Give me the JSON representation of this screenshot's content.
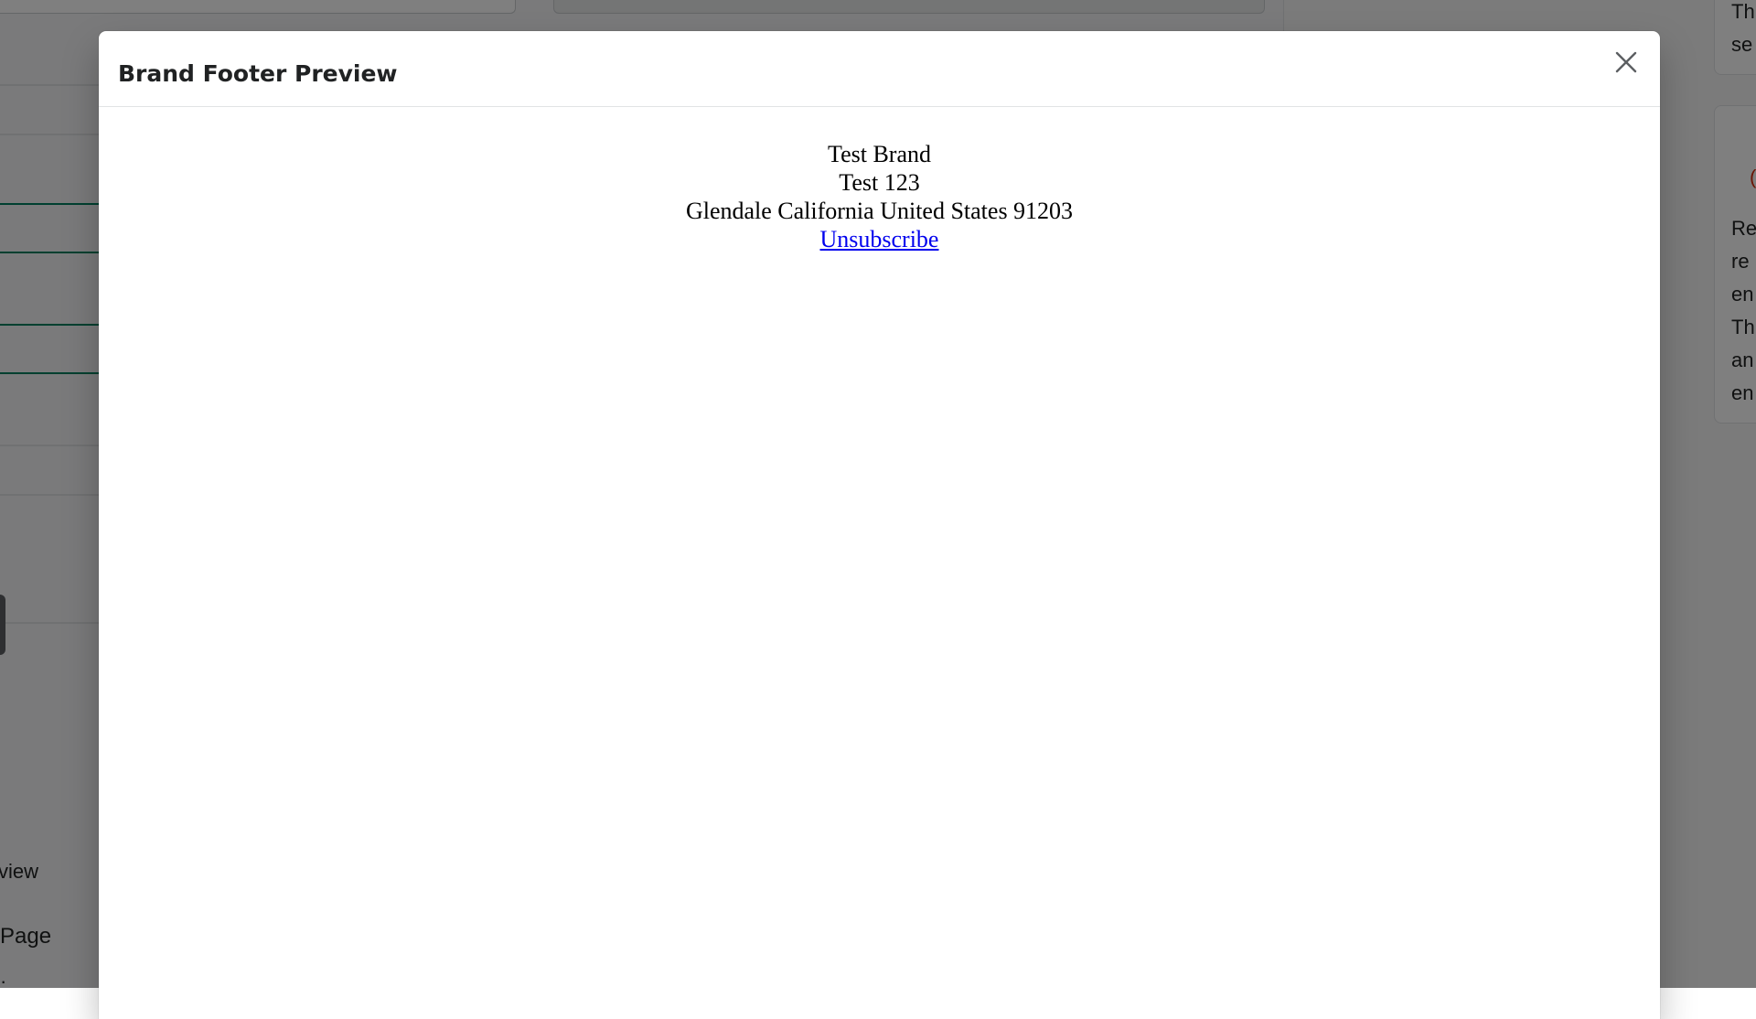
{
  "background": {
    "left_texts": [
      "view",
      "Page",
      "·"
    ],
    "right_card_1": [
      "Th",
      "se"
    ],
    "right_card_2_heading": "(",
    "right_card_2_lines": [
      "Re",
      "re",
      "en",
      "Th",
      "an",
      "en"
    ]
  },
  "modal": {
    "title": "Brand Footer Preview",
    "close_icon": "close-icon",
    "footer_preview": {
      "brand_name": "Test Brand",
      "address_line": "Test 123",
      "location_line": "Glendale California United States 91203",
      "unsubscribe_label": "Unsubscribe"
    }
  },
  "colors": {
    "overlay": "rgba(0,0,0,0.5)",
    "link": "#0000ee",
    "accent_green": "#008060"
  }
}
